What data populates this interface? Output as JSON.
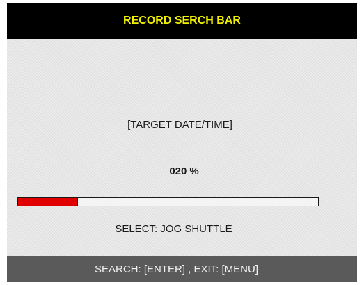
{
  "header": {
    "title": "RECORD SERCH BAR"
  },
  "main": {
    "target_label": "[TARGET DATE/TIME]",
    "progress": {
      "value_text": "020",
      "unit": "%",
      "fraction": 0.2
    },
    "select_label": "SELECT: JOG SHUTTLE"
  },
  "footer": {
    "hint": "SEARCH: [ENTER] , EXIT: [MENU]"
  },
  "colors": {
    "title_bar_bg": "#000000",
    "title_text": "#f0f000",
    "panel_bg": "#e6e6e6",
    "progress_fill": "#e10000",
    "footer_bg": "#5a5a5a",
    "footer_text": "#f2f2f2"
  }
}
